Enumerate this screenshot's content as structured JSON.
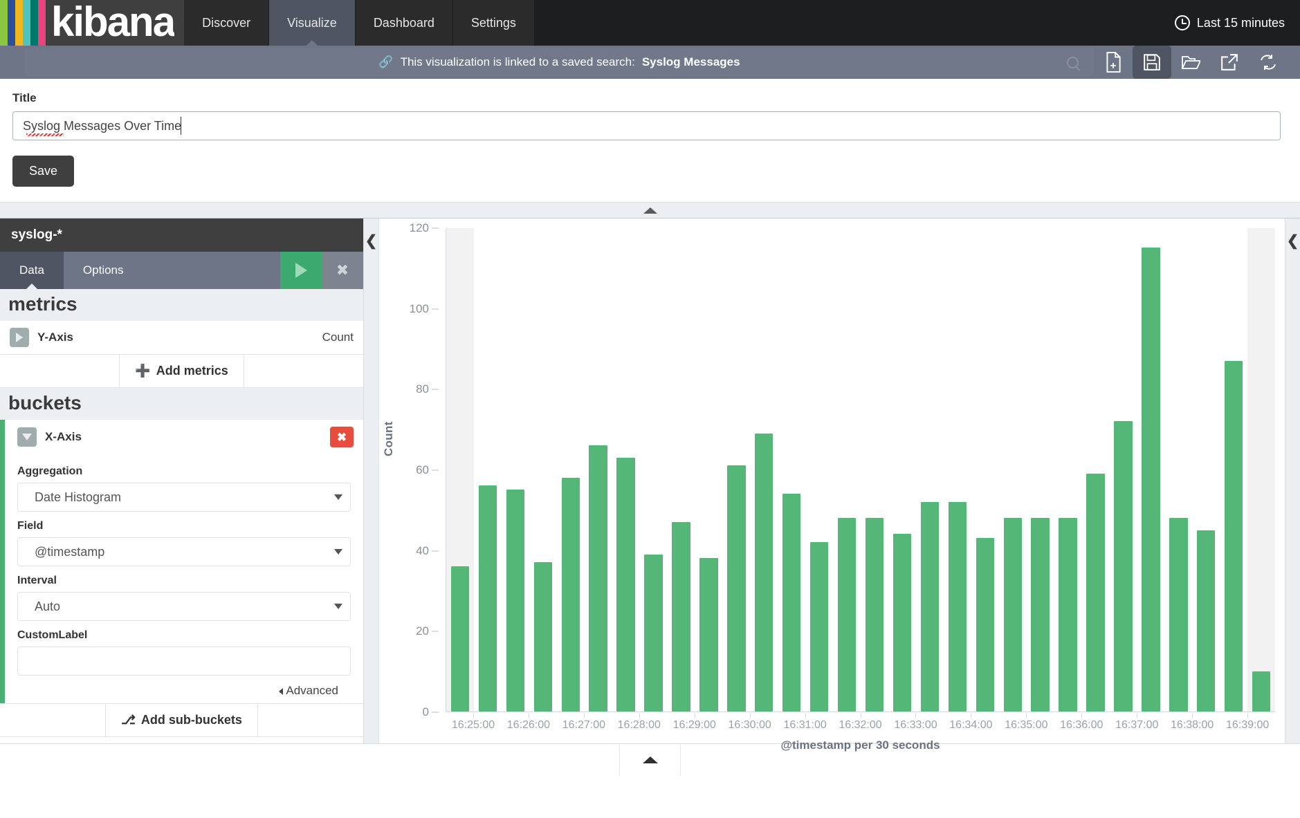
{
  "app": {
    "brand": "kibana",
    "logo_colors": [
      "#8cc63f",
      "#2e4f9e",
      "#f0b81c",
      "#4fc3c0",
      "#00796b",
      "#e8437f"
    ]
  },
  "topnav": {
    "items": [
      {
        "label": "Discover",
        "active": false
      },
      {
        "label": "Visualize",
        "active": true
      },
      {
        "label": "Dashboard",
        "active": false
      },
      {
        "label": "Settings",
        "active": false
      }
    ],
    "timepicker": {
      "icon": "clock-icon",
      "label": "Last 15 minutes"
    }
  },
  "querybar": {
    "linked_prefix": "This visualization is linked to a saved search:",
    "linked_search": "Syslog Messages",
    "link_icon": "link-icon",
    "search_icon": "search-icon",
    "tools": [
      {
        "name": "new-visualization-button",
        "icon": "new-document-icon",
        "active": false
      },
      {
        "name": "save-visualization-button",
        "icon": "save-disk-icon",
        "active": true
      },
      {
        "name": "open-visualization-button",
        "icon": "open-folder-icon",
        "active": false
      },
      {
        "name": "share-visualization-button",
        "icon": "external-link-icon",
        "active": false
      },
      {
        "name": "refresh-button",
        "icon": "refresh-icon",
        "active": false
      }
    ]
  },
  "title_panel": {
    "label": "Title",
    "value": "Syslog Messages Over Time",
    "placeholder": "",
    "save_label": "Save"
  },
  "sidebar": {
    "index_pattern": "syslog-*",
    "tabs": [
      {
        "label": "Data",
        "active": true
      },
      {
        "label": "Options",
        "active": false
      }
    ],
    "apply_icon": "play-icon",
    "cancel_icon": "close-icon",
    "metrics": {
      "heading": "metrics",
      "rows": [
        {
          "label": "Y-Axis",
          "value": "Count"
        }
      ],
      "add_label": "Add metrics",
      "add_icon": "plus-icon"
    },
    "buckets": {
      "heading": "buckets",
      "row_label": "X-Axis",
      "delete_icon": "close-icon",
      "fields": [
        {
          "label": "Aggregation",
          "value": "Date Histogram",
          "type": "select"
        },
        {
          "label": "Field",
          "value": "@timestamp",
          "type": "select"
        },
        {
          "label": "Interval",
          "value": "Auto",
          "type": "select"
        },
        {
          "label": "CustomLabel",
          "value": "",
          "type": "text"
        }
      ],
      "advanced_label": "Advanced",
      "add_label": "Add sub-buckets",
      "add_icon": "branch-icon"
    }
  },
  "panel_controls": {
    "top_collapse_icon": "chevron-up-icon",
    "left_collapse_icon": "chevron-left-icon",
    "right_collapse_icon": "chevron-left-icon",
    "bottom_collapse_icon": "chevron-up-icon"
  },
  "chart_data": {
    "type": "bar",
    "title": "",
    "xlabel": "@timestamp per 30 seconds",
    "ylabel": "Count",
    "ylim": [
      0,
      120
    ],
    "yticks": [
      0,
      20,
      40,
      60,
      80,
      100,
      120
    ],
    "grid": false,
    "legend": "none",
    "bar_color": "#54b677",
    "categories": [
      "16:24:30",
      "16:25:00",
      "16:25:30",
      "16:26:00",
      "16:26:30",
      "16:27:00",
      "16:27:30",
      "16:28:00",
      "16:28:30",
      "16:29:00",
      "16:29:30",
      "16:30:00",
      "16:30:30",
      "16:31:00",
      "16:31:30",
      "16:32:00",
      "16:32:30",
      "16:33:00",
      "16:33:30",
      "16:34:00",
      "16:34:30",
      "16:35:00",
      "16:35:30",
      "16:36:00",
      "16:36:30",
      "16:37:00",
      "16:37:30",
      "16:38:00",
      "16:38:30",
      "16:39:00"
    ],
    "values": [
      36,
      56,
      55,
      37,
      58,
      66,
      63,
      39,
      47,
      38,
      61,
      69,
      54,
      42,
      48,
      48,
      44,
      52,
      52,
      43,
      48,
      48,
      48,
      59,
      72,
      115,
      48,
      45,
      87,
      10
    ],
    "highlighted_indices": [
      0,
      29
    ],
    "xtick_labels": [
      "16:25:00",
      "16:26:00",
      "16:27:00",
      "16:28:00",
      "16:29:00",
      "16:30:00",
      "16:31:00",
      "16:32:00",
      "16:33:00",
      "16:34:00",
      "16:35:00",
      "16:36:00",
      "16:37:00",
      "16:38:00",
      "16:39:00"
    ]
  }
}
